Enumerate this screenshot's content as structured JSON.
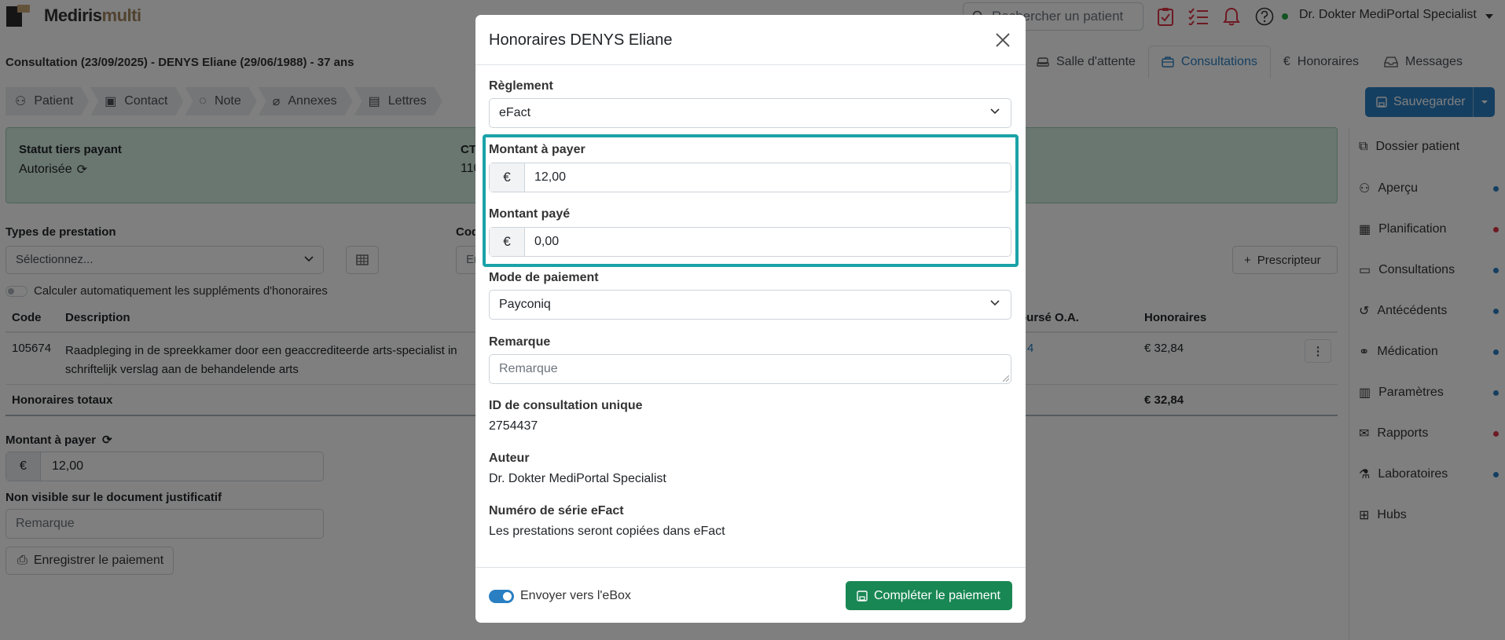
{
  "app": {
    "logo_text_dark": "M",
    "logo_text_a": "ediris",
    "logo_text_b": "multi"
  },
  "topbar": {
    "search_placeholder": "Rechercher un patient",
    "user_name": "Dr. Dokter MediPortal Specialist",
    "icons": [
      "clipboard-check-icon",
      "list-check-icon",
      "bell-icon",
      "help-icon"
    ]
  },
  "consultation": {
    "title": "Consultation (23/09/2025) - DENYS Eliane (29/06/1988) - 37 ans"
  },
  "main_tabs": [
    {
      "label": "Salle d'attente",
      "icon": "couch-icon"
    },
    {
      "label": "Consultations",
      "icon": "briefcase-icon",
      "active": true
    },
    {
      "label": "Honoraires",
      "icon": "euro-icon"
    },
    {
      "label": "Messages",
      "icon": "inbox-icon"
    }
  ],
  "sub_tabs": [
    {
      "label": "Patient",
      "icon": "person-icon"
    },
    {
      "label": "Contact",
      "icon": "contact-icon"
    },
    {
      "label": "Note",
      "icon": "chat-icon"
    },
    {
      "label": "Annexes",
      "icon": "paperclip-icon"
    },
    {
      "label": "Lettres",
      "icon": "letters-icon"
    }
  ],
  "save_button": {
    "label": "Sauvegarder"
  },
  "status": {
    "label": "Statut tiers payant",
    "value": "Autorisée",
    "ct_label": "CT",
    "ct_value": "110"
  },
  "prestations": {
    "types_label": "Types de prestation",
    "types_placeholder": "Sélectionnez...",
    "code_label": "Cod",
    "code_placeholder": "En",
    "prescriber_button": "Prescripteur",
    "auto_toggle_label": "Calculer automatiquement les suppléments d'honoraires",
    "columns": {
      "code": "Code",
      "description": "Description",
      "refund": "oursé O.A.",
      "fees": "Honoraires"
    },
    "rows": [
      {
        "code": "105674",
        "description": "Raadpleging in de spreekkamer door een geaccrediteerde arts-specialist in schriftelijk verslag aan de behandelende arts",
        "refund": "4",
        "fees": "€ 32,84"
      }
    ],
    "total_label": "Honoraires totaux",
    "total_value": "€ 32,84"
  },
  "payment_bg": {
    "amount_label": "Montant à payer",
    "currency": "€",
    "amount_value": "12,00",
    "nonvisible_label": "Non visible sur le document justificatif",
    "remark_placeholder": "Remarque",
    "register_button": "Enregistrer le paiement"
  },
  "sidebar": {
    "items": [
      {
        "label": "Dossier patient",
        "icon": "external-link-icon",
        "dot": ""
      },
      {
        "label": "Aperçu",
        "icon": "person-icon",
        "dot": "#2a7fc2"
      },
      {
        "label": "Planification",
        "icon": "calendar-icon",
        "dot": "#dc3545"
      },
      {
        "label": "Consultations",
        "icon": "briefcase-icon",
        "dot": "#2a7fc2"
      },
      {
        "label": "Antécédents",
        "icon": "history-icon",
        "dot": "#2a7fc2"
      },
      {
        "label": "Médication",
        "icon": "pills-icon",
        "dot": "#2a7fc2"
      },
      {
        "label": "Paramètres",
        "icon": "bar-chart-icon",
        "dot": "#2a7fc2"
      },
      {
        "label": "Rapports",
        "icon": "envelope-icon",
        "dot": "#dc3545"
      },
      {
        "label": "Laboratoires",
        "icon": "flask-icon",
        "dot": "#2a7fc2"
      },
      {
        "label": "Hubs",
        "icon": "hub-icon",
        "dot": ""
      }
    ]
  },
  "modal": {
    "title": "Honoraires DENYS Eliane",
    "reglement_label": "Règlement",
    "reglement_value": "eFact",
    "amount_label": "Montant à payer",
    "currency": "€",
    "amount_value": "12,00",
    "paid_label": "Montant payé",
    "paid_value": "0,00",
    "payment_mode_label": "Mode de paiement",
    "payment_mode_value": "Payconiq",
    "remark_label": "Remarque",
    "remark_placeholder": "Remarque",
    "unique_id_label": "ID de consultation unique",
    "unique_id_value": "2754437",
    "author_label": "Auteur",
    "author_value": "Dr. Dokter MediPortal Specialist",
    "serial_label": "Numéro de série eFact",
    "serial_value": "Les prestations seront copiées dans eFact",
    "ebox_label": "Envoyer vers l'eBox",
    "complete_button": "Compléter le paiement",
    "highlight_color": "#1aa3a8"
  }
}
